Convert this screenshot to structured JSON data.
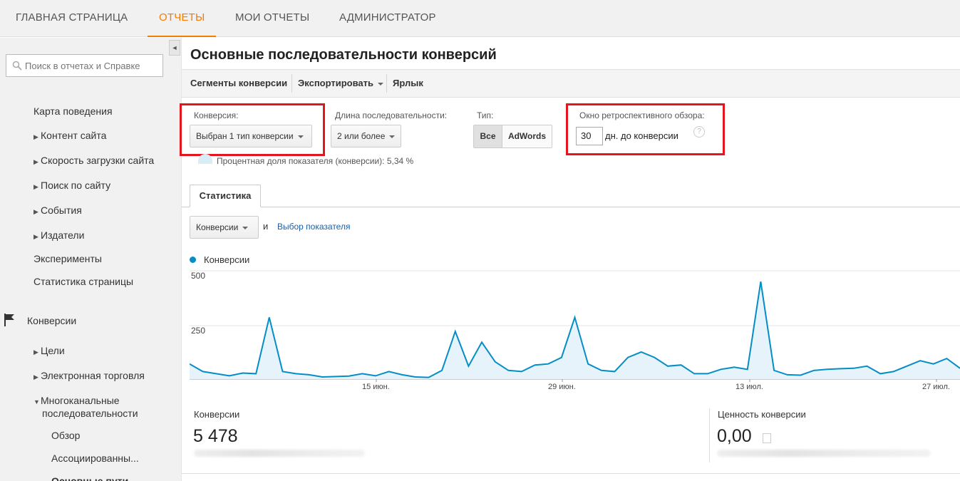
{
  "topnav": {
    "tabs": [
      {
        "label": "ГЛАВНАЯ СТРАНИЦА"
      },
      {
        "label": "ОТЧЕТЫ"
      },
      {
        "label": "МОИ ОТЧЕТЫ"
      },
      {
        "label": "АДМИНИСТРАТОР"
      }
    ],
    "active_index": 1
  },
  "sidebar": {
    "search_placeholder": "Поиск в отчетах и Справке",
    "items": [
      {
        "label": "Карта поведения"
      },
      {
        "label": "Контент сайта"
      },
      {
        "label": "Скорость загрузки сайта"
      },
      {
        "label": "Поиск по сайту"
      },
      {
        "label": "События"
      },
      {
        "label": "Издатели"
      },
      {
        "label": "Эксперименты"
      },
      {
        "label": "Статистика страницы"
      },
      {
        "label": "Конверсии"
      },
      {
        "label": "Цели"
      },
      {
        "label": "Электронная торговля"
      },
      {
        "label": "Многоканальные последовательности"
      },
      {
        "label": "Обзор"
      },
      {
        "label": "Ассоциированны..."
      },
      {
        "label": "Основные пути"
      }
    ],
    "items_line2": "последовательности",
    "items_line1": "Многоканальные"
  },
  "main": {
    "title": "Основные последовательности конверсий",
    "toolbar": {
      "segments": "Сегменты конверсии",
      "export": "Экспортировать",
      "shortcut": "Ярлык"
    },
    "controls": {
      "conversion_label": "Конверсия:",
      "conversion_value": "Выбран 1 тип конверсии",
      "length_label": "Длина последовательности:",
      "length_value": "2 или более",
      "type_label": "Тип:",
      "type_all": "Все",
      "type_adwords": "AdWords",
      "lookback_label": "Окно ретроспективного обзора:",
      "lookback_days": "30",
      "lookback_suffix": "дн. до конверсии",
      "help": "?"
    },
    "metric_share": "Процентная доля показателя (конверсии): 5,34 %",
    "tab": "Статистика",
    "metric_dropdown": "Конверсии",
    "and": "и",
    "choose_metric": "Выбор показателя",
    "legend": "Конверсии",
    "summary": [
      {
        "label": "Конверсии",
        "value": "5 478"
      },
      {
        "label": "Ценность конверсии",
        "value": "0,00"
      }
    ]
  },
  "colors": {
    "accent": "#f57c00",
    "line": "#058dc7",
    "fill": "#e6f3fa",
    "highlight": "#e3161d"
  },
  "chart_data": {
    "type": "area",
    "series": [
      {
        "name": "Конверсии",
        "values": [
          70,
          35,
          25,
          15,
          28,
          25,
          285,
          35,
          25,
          20,
          10,
          12,
          14,
          25,
          15,
          35,
          20,
          10,
          8,
          40,
          220,
          60,
          170,
          80,
          40,
          35,
          65,
          70,
          100,
          285,
          70,
          40,
          35,
          100,
          125,
          100,
          60,
          65,
          25,
          25,
          45,
          55,
          45,
          450,
          40,
          20,
          18,
          40,
          45,
          48,
          50,
          60,
          25,
          35,
          60,
          85,
          70,
          95,
          50
        ]
      }
    ],
    "x_ticks": [
      "15 июн.",
      "29 июн.",
      "13 июл.",
      "27 июл."
    ],
    "y_ticks": [
      "500",
      "250"
    ],
    "ylim": [
      0,
      500
    ]
  }
}
